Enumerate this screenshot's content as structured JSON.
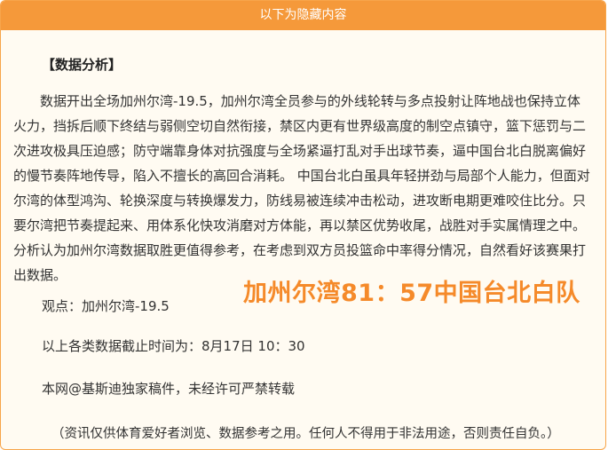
{
  "header": {
    "title": "以下为隐藏内容"
  },
  "section_title": "【数据分析】",
  "analysis_text": "数据开出全场加州尔湾-19.5，加州尔湾全员参与的外线轮转与多点投射让阵地战也保持立体火力，挡拆后顺下终结与弱侧空切自然衔接，禁区内更有世界级高度的制空点镇守，篮下惩罚与二次进攻极具压迫感；防守端靠身体对抗强度与全场紧逼打乱对手出球节奏，逼中国台北白脱离偏好的慢节奏阵地传导，陷入不擅长的高回合消耗。 中国台北白虽具年轻拼劲与局部个人能力，但面对尔湾的体型鸿沟、轮换深度与转换爆发力，防线易被连续冲击松动，进攻断电期更难咬住比分。只要尔湾把节奏提起来、用体系化快攻消磨对方体能，再以禁区优势收尾，战胜对手实属情理之中。分析认为加州尔湾数据取胜更值得参考，在考虑到双方员投篮命中率得分情况，自然看好该赛果打出数据。",
  "viewpoint": "观点：加州尔湾-19.5",
  "prediction": "加州尔湾81：57中国台北白队",
  "cutoff_time": "以上各类数据截止时间为：8月17日 10：30",
  "copyright": "本网@基斯迪独家稿件，未经许可严禁转载",
  "disclaimer": "（资讯仅供体育爱好者浏览、数据参考之用。任何人不得用于非法用途，否则责任自负。）",
  "colors": {
    "header_bg": "#f5993a",
    "border": "#f7a54a",
    "panel_bg": "#fffbf2",
    "prediction": "#f58a2a"
  }
}
